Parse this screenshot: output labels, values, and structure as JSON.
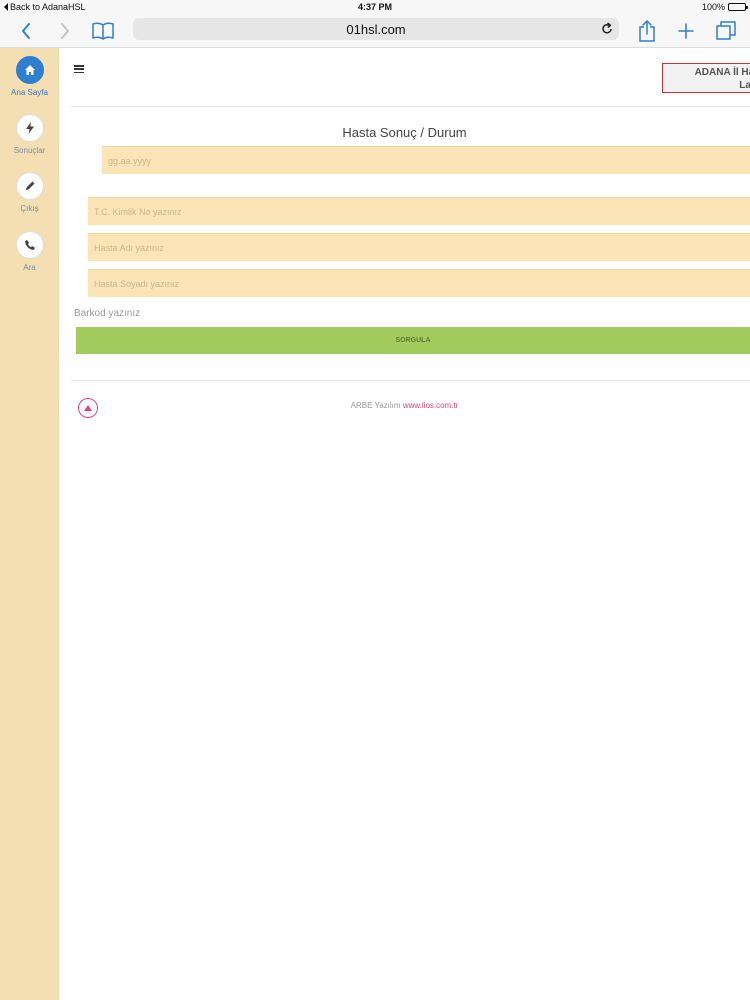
{
  "status_bar": {
    "back_label": "Back to AdanaHSL",
    "time": "4:37 PM",
    "battery": "100%",
    "battery_level": 1.0
  },
  "browser": {
    "url": "01hsl.com",
    "icons": [
      "back-chevron-icon",
      "forward-chevron-icon",
      "bookmarks-book-icon",
      "reload-icon",
      "share-icon",
      "plus-icon",
      "tabs-icon"
    ]
  },
  "sidebar": {
    "items": [
      {
        "label": "Ana Sayfa",
        "icon": "home-icon",
        "active": true
      },
      {
        "label": "Sonuçlar",
        "icon": "lightning-icon",
        "active": false
      },
      {
        "label": "Çıkış",
        "icon": "pencil-icon",
        "active": false
      },
      {
        "label": "Ara",
        "icon": "phone-icon",
        "active": false
      }
    ]
  },
  "header": {
    "brand_line1": "ADANA İl Hal",
    "brand_line2": "Lab"
  },
  "form": {
    "title": "Hasta Sonuç / Durum",
    "date_placeholder": "gg.aa.yyyy",
    "tc_placeholder": "T.C. Kimlik No yazınız",
    "name_placeholder": "Hasta Adı yazınız",
    "surname_placeholder": "Hasta Soyadı yazınız",
    "barkod_label": "Barkod yazınız",
    "submit_label": "SORGULA"
  },
  "footer": {
    "company": "ARBE Yazılım",
    "link": "www.lios.com.tr"
  },
  "colors": {
    "sidebar_bg": "#f4dfb3",
    "input_bg": "#fbe4b6",
    "button_green": "#a3cc5f",
    "active_blue": "#2f7fd0",
    "accent_pink": "#e0427a",
    "brand_border": "#d03030"
  }
}
